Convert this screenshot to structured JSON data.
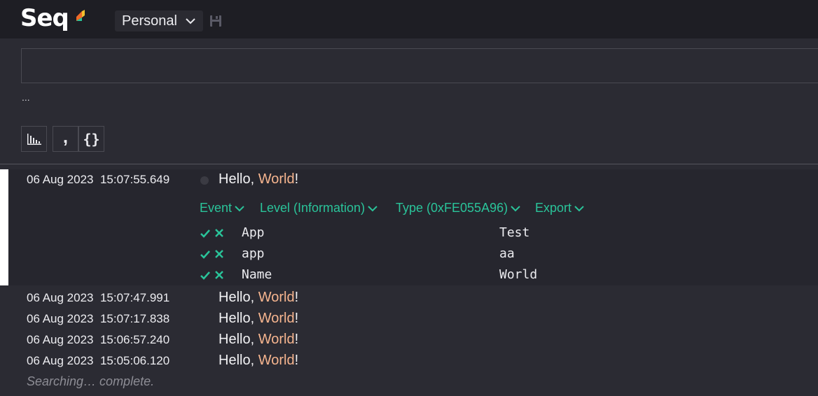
{
  "app": {
    "name": "Seq"
  },
  "workspace": {
    "label": "Personal"
  },
  "search": {
    "value": "",
    "placeholder": ""
  },
  "search_hint": "...",
  "toolbar": {
    "comma_label": ",",
    "json_label": "{}"
  },
  "events": [
    {
      "date": "06 Aug 2023",
      "time": "15:07:55.649",
      "message_prefix": "Hello, ",
      "message_value": "World",
      "message_suffix": "!"
    },
    {
      "date": "06 Aug 2023",
      "time": "15:07:47.991",
      "message_prefix": "Hello, ",
      "message_value": "World",
      "message_suffix": "!"
    },
    {
      "date": "06 Aug 2023",
      "time": "15:07:17.838",
      "message_prefix": "Hello, ",
      "message_value": "World",
      "message_suffix": "!"
    },
    {
      "date": "06 Aug 2023",
      "time": "15:06:57.240",
      "message_prefix": "Hello, ",
      "message_value": "World",
      "message_suffix": "!"
    },
    {
      "date": "06 Aug 2023",
      "time": "15:05:06.120",
      "message_prefix": "Hello, ",
      "message_value": "World",
      "message_suffix": "!"
    }
  ],
  "detail": {
    "menus": [
      "Event",
      "Level (Information)",
      "Type (0xFE055A96)",
      "Export"
    ],
    "properties": [
      {
        "name": "App",
        "value": "Test"
      },
      {
        "name": "app",
        "value": "aa"
      },
      {
        "name": "Name",
        "value": "World"
      }
    ]
  },
  "status": "Searching… complete.",
  "colors": {
    "accent": "#2ac49a",
    "property_value": "#f6b58f",
    "topbar": "#1e1e24",
    "background": "#2b2b33"
  }
}
